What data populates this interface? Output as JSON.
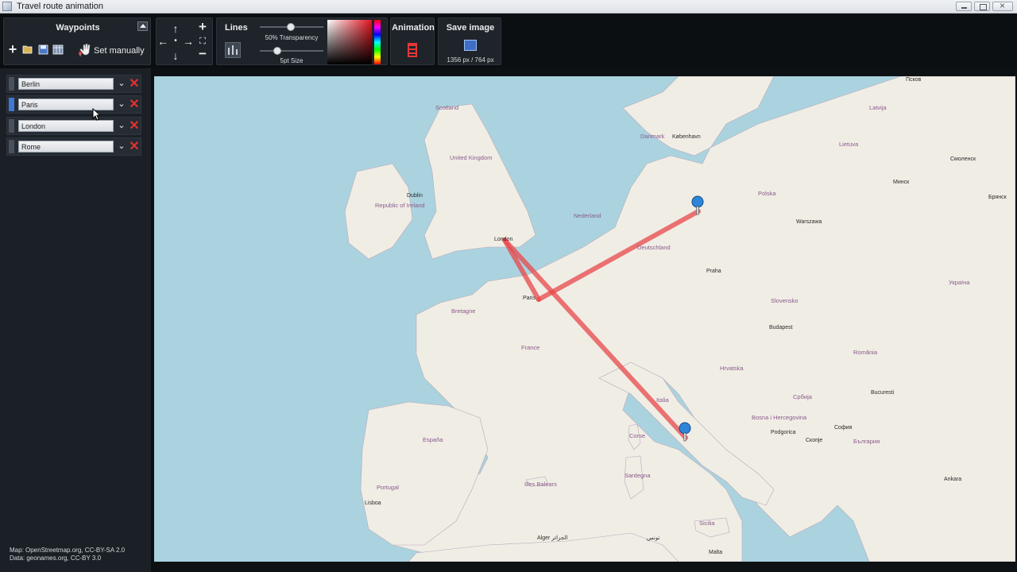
{
  "window": {
    "title": "Travel route animation"
  },
  "toolbar": {
    "waypoints_title": "Waypoints",
    "set_manually": "Set manually",
    "lines_title": "Lines",
    "transparency_label": "50% Transparency",
    "size_label": "5pt Size",
    "animation_title": "Animation",
    "save_title": "Save image",
    "save_size": "1356 px / 764 px"
  },
  "waypoints": [
    {
      "value": "Berlin"
    },
    {
      "value": "Paris"
    },
    {
      "value": "London"
    },
    {
      "value": "Rome"
    }
  ],
  "attribution": {
    "map": "Map: OpenStreetmap.org, CC-BY-SA 2.0",
    "data": "Data: geonames.org, CC-BY 3.0"
  },
  "map_labels": {
    "kobenhavn": "København",
    "dublin": "Dublin",
    "london": "London",
    "paris": "Paris",
    "praha": "Praha",
    "warszawa": "Warszawa",
    "budapest": "Budapest",
    "lisboa": "Lisboa",
    "podgorica": "Podgorica",
    "skopje": "Скопје",
    "sofia": "София",
    "bucuresti": "Bucuresti",
    "ankara": "Ankara",
    "minsk": "Минск",
    "smolensk": "Смоленск",
    "pskov": "Псков",
    "bryansk": "Брянск",
    "algiers": "Alger الجزائر",
    "tunis": "تونس",
    "malta": "Malta",
    "scotland": "Scotland",
    "united_kingdom": "United Kingdom",
    "republic_ireland": "Republic of Ireland",
    "danmark": "Danmark",
    "nederland": "Nederland",
    "deutschland": "Deutschland",
    "france": "France",
    "espana": "España",
    "portugal": "Portugal",
    "italia": "Italia",
    "polska": "Polska",
    "ukraina": "Україна",
    "hrvatska": "Hrvatska",
    "srbija": "Србија",
    "romania": "România",
    "bulgaria": "България",
    "latvija": "Latvija",
    "lietuva": "Lietuva",
    "slovensko": "Slovensko",
    "sardegna": "Sardegna",
    "corse": "Corse",
    "sicilia": "Sicilia",
    "islas_baleares": "Illes Balears",
    "bretagne": "Bretagne",
    "bosnia": "Bosna i Hercegovina"
  },
  "route": {
    "line_color": "#e8474a",
    "marker_color": "#2f86d8"
  }
}
